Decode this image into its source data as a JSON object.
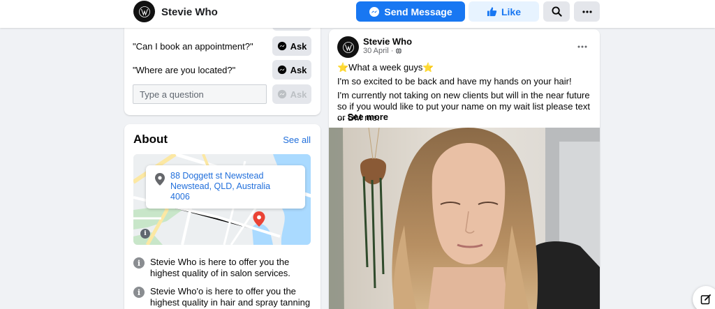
{
  "header": {
    "page_name": "Stevie Who",
    "send_message_label": "Send Message",
    "like_label": "Like"
  },
  "faq": {
    "questions": [
      {
        "text": "\"Can I book an appointment?\"",
        "ask_label": "Ask"
      },
      {
        "text": "\"Where are you located?\"",
        "ask_label": "Ask"
      }
    ],
    "input_placeholder": "Type a question",
    "input_ask_label": "Ask"
  },
  "about": {
    "title": "About",
    "see_all": "See all",
    "address_line1": "88 Doggett st Newstead",
    "address_line2": "Newstead, QLD, Australia",
    "address_line3": "4006",
    "info": [
      "Stevie Who is here to offer you the highest quality of in salon services.",
      "Stevie Who'o is here to offer you the highest quality in hair and spray tanning"
    ]
  },
  "post": {
    "author": "Stevie Who",
    "date": "30 April ·",
    "headline": "⭐What a week guys⭐",
    "line1": "I'm so excited to be back and have my hands on your hair!",
    "line2": "I'm currently not taking on new clients but will in the near future so if you would like to put your name on my wait list please text or DM me.",
    "see_more": "... See more"
  },
  "colors": {
    "brand_blue": "#1877f2",
    "link_blue": "#216fdb",
    "light_blue_bg": "#e7f3ff",
    "gray_button": "#e4e6eb",
    "page_bg": "#f0f2f5"
  }
}
